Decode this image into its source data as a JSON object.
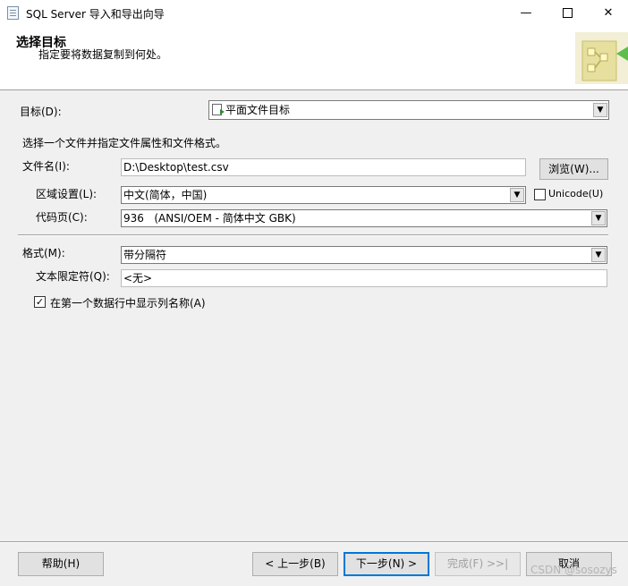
{
  "window": {
    "title": "SQL Server 导入和导出向导",
    "minimize_glyph": "—",
    "close_glyph": "✕"
  },
  "header": {
    "title": "选择目标",
    "subtitle": "指定要将数据复制到何处。"
  },
  "destination": {
    "label": "目标(D):",
    "value": "平面文件目标",
    "icon": "flat-file-icon"
  },
  "file_section": {
    "instruction": "选择一个文件并指定文件属性和文件格式。",
    "filename_label": "文件名(I):",
    "filename_value": "D:\\Desktop\\test.csv",
    "browse_label": "浏览(W)...",
    "locale_label": "区域设置(L):",
    "locale_value": "中文(简体，中国)",
    "unicode_label": "Unicode(U)",
    "unicode_checked": false,
    "codepage_label": "代码页(C):",
    "codepage_value": "936   (ANSI/OEM - 简体中文 GBK)"
  },
  "format_section": {
    "format_label": "格式(M):",
    "format_value": "带分隔符",
    "qualifier_label": "文本限定符(Q):",
    "qualifier_value": "<无>",
    "header_row_label": "在第一个数据行中显示列名称(A)",
    "header_row_checked": true
  },
  "footer": {
    "help": "帮助(H)",
    "back": "< 上一步(B)",
    "next": "下一步(N) >",
    "finish": "完成(F) >>|",
    "cancel": "取消",
    "watermark": "CSDN @sosozys"
  },
  "glyphs": {
    "dropdown_arrow": "▼",
    "checkmark": "✓"
  }
}
